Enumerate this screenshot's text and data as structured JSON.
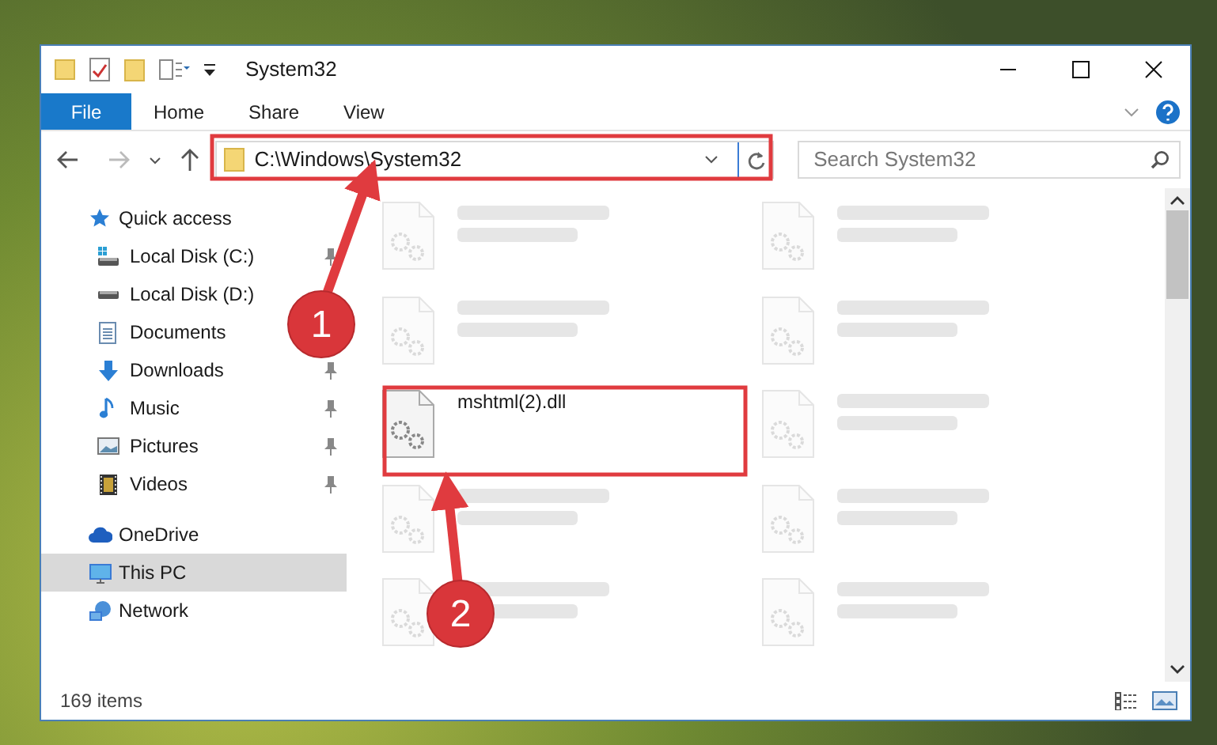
{
  "window": {
    "title": "System32"
  },
  "ribbon": {
    "tabs": [
      {
        "label": "File",
        "kind": "file",
        "selected": false
      },
      {
        "label": "Home",
        "kind": "tab",
        "selected": false
      },
      {
        "label": "Share",
        "kind": "tab",
        "selected": false
      },
      {
        "label": "View",
        "kind": "tab",
        "selected": false
      }
    ]
  },
  "address_bar": {
    "path": "C:\\Windows\\System32"
  },
  "search": {
    "placeholder": "Search System32"
  },
  "navigation": [
    {
      "label": "Quick access",
      "kind": "star",
      "selected": false,
      "children": [
        {
          "label": "Local Disk (C:)",
          "kind": "system-disk",
          "pinned": true
        },
        {
          "label": "Local Disk (D:)",
          "kind": "disk",
          "pinned": false
        },
        {
          "label": "Documents",
          "kind": "documents",
          "pinned": false
        },
        {
          "label": "Downloads",
          "kind": "downloads",
          "pinned": true
        },
        {
          "label": "Music",
          "kind": "music",
          "pinned": true
        },
        {
          "label": "Pictures",
          "kind": "pictures",
          "pinned": true
        },
        {
          "label": "Videos",
          "kind": "videos",
          "pinned": true
        }
      ]
    },
    {
      "label": "OneDrive",
      "kind": "cloud",
      "selected": false
    },
    {
      "label": "This PC",
      "kind": "pc",
      "selected": true
    },
    {
      "label": "Network",
      "kind": "network",
      "selected": false
    }
  ],
  "files": [
    {
      "dimmed": true
    },
    {
      "dimmed": true
    },
    {
      "dimmed": true
    },
    {
      "dimmed": true
    },
    {
      "name": "mshtml(2).dll",
      "dimmed": false
    },
    {
      "dimmed": true
    },
    {
      "dimmed": true
    },
    {
      "dimmed": true
    },
    {
      "dimmed": true
    },
    {
      "dimmed": true
    }
  ],
  "status_bar": {
    "item_count": "169 items"
  },
  "annotations": [
    {
      "label": "1"
    },
    {
      "label": "2"
    }
  ]
}
